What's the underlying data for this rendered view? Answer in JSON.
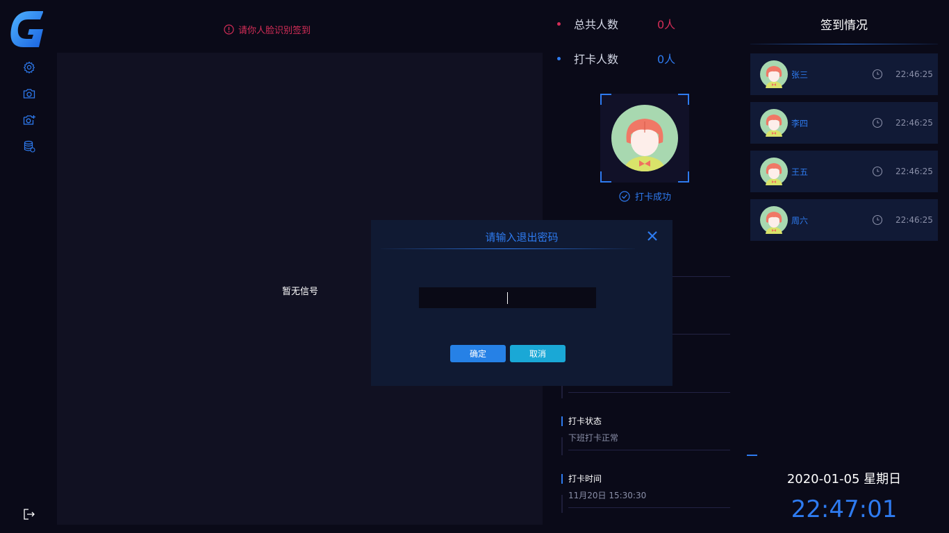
{
  "header": {
    "hint": "请你人脸识别签到"
  },
  "video": {
    "no_signal": "暂无信号"
  },
  "stats": [
    {
      "label": "总共人数",
      "value": "0人",
      "color": "#d42d57"
    },
    {
      "label": "打卡人数",
      "value": "0人",
      "color": "#2e7bf0"
    }
  ],
  "capture": {
    "status": "打卡成功"
  },
  "info": [
    {
      "title": "打卡状态",
      "value": "下班打卡正常"
    },
    {
      "title": "打卡时间",
      "value": "11月20日 15:30:30"
    }
  ],
  "records": {
    "title": "签到情况",
    "items": [
      {
        "name": "张三",
        "time": "22:46:25"
      },
      {
        "name": "李四",
        "time": "22:46:25"
      },
      {
        "name": "王五",
        "time": "22:46:25"
      },
      {
        "name": "周六",
        "time": "22:46:25"
      }
    ]
  },
  "footer": {
    "date": "2020-01-05 星期日",
    "time": "22:47:01"
  },
  "modal": {
    "title": "请输入退出密码",
    "password_value": "",
    "confirm_label": "确定",
    "cancel_label": "取消"
  },
  "icons": {
    "logo": "g-logo",
    "rail": [
      "gear-icon",
      "camera-icon",
      "camera-add-icon",
      "database-icon"
    ],
    "logout": "logout-icon"
  },
  "colors": {
    "accent": "#2e7bf0",
    "alert": "#d42d57",
    "background": "#0a0a18",
    "panel": "#111a36"
  }
}
